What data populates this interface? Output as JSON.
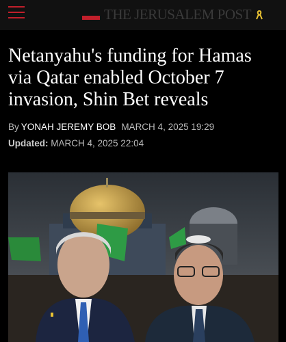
{
  "header": {
    "menu_icon": "hamburger-menu-icon",
    "logo_text": "THE JERUSALEM POST",
    "ribbon_icon": "yellow-ribbon-icon",
    "accent_color": "#c21f2b",
    "ribbon_color": "#e9c232"
  },
  "article": {
    "headline": "Netanyahu's funding for Hamas via Qatar enabled October 7 invasion, Shin Bet reveals",
    "by_label": "By",
    "author": "YONAH JEREMY BOB",
    "published": "MARCH 4, 2025 19:29",
    "updated_label": "Updated:",
    "updated": "MARCH 4, 2025 22:04"
  }
}
